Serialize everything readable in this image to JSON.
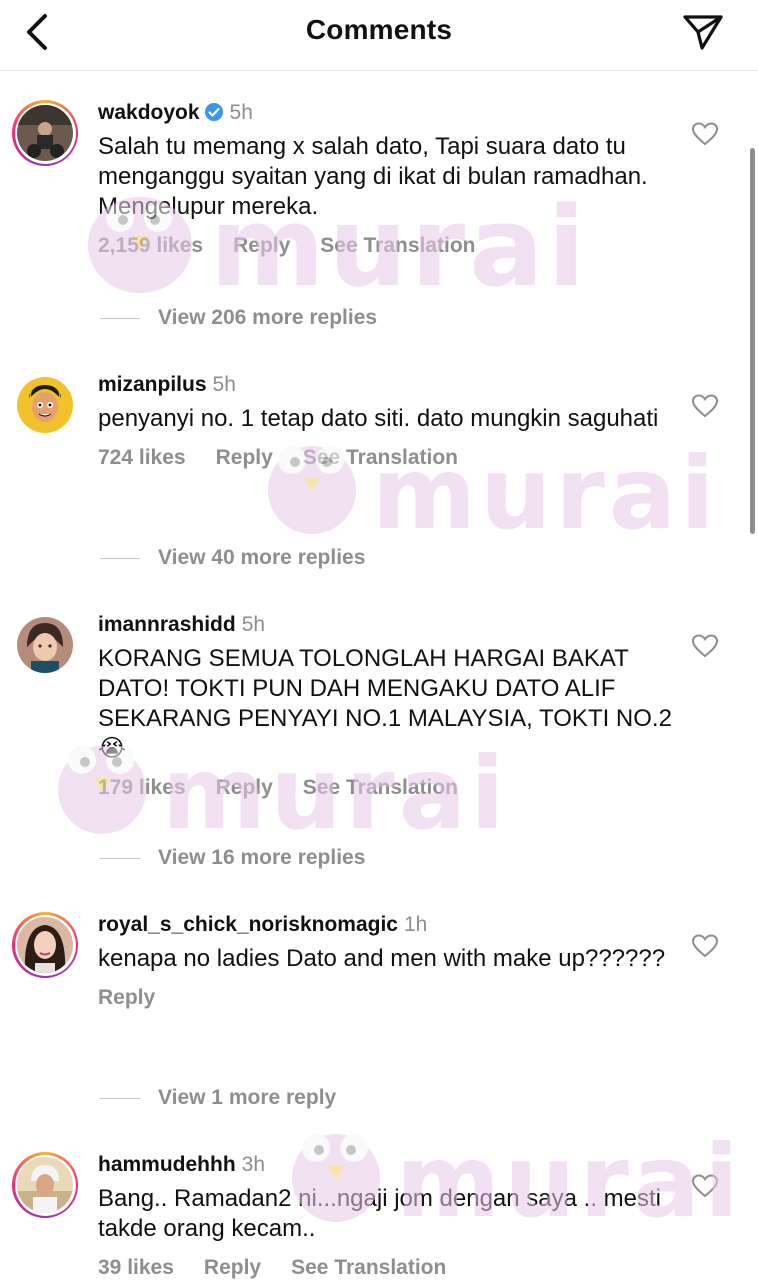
{
  "header": {
    "title": "Comments"
  },
  "comments": [
    {
      "username": "wakdoyok",
      "verified": true,
      "time": "5h",
      "text": "Salah tu memang x salah dato, Tapi suara dato tu menganggu syaitan yang di ikat di bulan ramadhan. Mengelupur mereka.",
      "likes": "2,159 likes",
      "reply": "Reply",
      "translate": "See Translation",
      "view_replies": "View 206 more replies"
    },
    {
      "username": "mizanpilus",
      "time": "5h",
      "text": "penyanyi no. 1 tetap dato siti. dato mungkin saguhati",
      "likes": "724 likes",
      "reply": "Reply",
      "translate": "See Translation",
      "view_replies": "View 40 more replies"
    },
    {
      "username": "imannrashidd",
      "time": "5h",
      "text": "KORANG SEMUA TOLONGLAH HARGAI BAKAT DATO! TOKTI PUN DAH MENGAKU DATO ALIF SEKARANG PENYAYI NO.1 MALAYSIA, TOKTI NO.2",
      "emoji": "😭",
      "likes": "179 likes",
      "reply": "Reply",
      "translate": "See Translation",
      "view_replies": "View 16 more replies"
    },
    {
      "username": "royal_s_chick_norisknomagic",
      "time": "1h",
      "text": "kenapa no ladies Dato and men with make up??????",
      "reply": "Reply",
      "view_replies": "View 1 more reply"
    },
    {
      "username": "hammudehhh",
      "time": "3h",
      "text": "Bang.. Ramadan2 ni...ngaji jom dengan saya .. mesti takde orang kecam..",
      "likes": "39 likes",
      "reply": "Reply",
      "translate": "See Translation"
    }
  ],
  "watermark": {
    "text": "murai"
  },
  "colors": {
    "muted": "#8e8e8e",
    "verified": "#3897f0",
    "watermark": "#e8c7ea"
  },
  "icons": [
    "back-arrow-icon",
    "send-icon",
    "heart-icon",
    "verified-badge-icon"
  ]
}
